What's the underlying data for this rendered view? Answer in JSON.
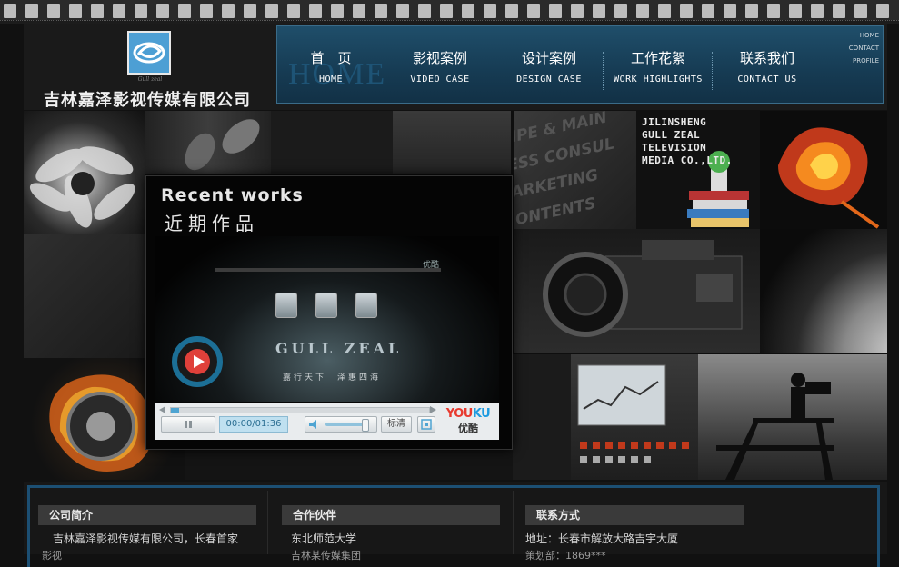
{
  "header": {
    "company_name": "吉林嘉泽影视传媒有限公司",
    "logo_sub": "Gull zeal"
  },
  "nav": {
    "ghost_text": "HOME",
    "items": [
      {
        "cn": "首　页",
        "en": "HOME"
      },
      {
        "cn": "影视案例",
        "en": "VIDEO CASE"
      },
      {
        "cn": "设计案例",
        "en": "DESIGN CASE"
      },
      {
        "cn": "工作花絮",
        "en": "WORK HIGHLIGHTS"
      },
      {
        "cn": "联系我们",
        "en": "CONTACT US"
      }
    ],
    "side_links": [
      "HOME",
      "CONTACT",
      "PROFILE"
    ]
  },
  "showcase": {
    "recent_title": "Recent works",
    "recent_cn": "近期作品",
    "jilin_lines": [
      "JILINSHENG",
      "GULL ZEAL",
      "TELEVISION",
      "MEDIA CO.,LTD."
    ]
  },
  "player": {
    "screen_provider": "优酷",
    "screen_brand": "GULL ZEAL",
    "screen_slogan": "嘉行天下　泽惠四海",
    "time": "00:00/01:36",
    "quality": "标清",
    "youku_en_a": "YOU",
    "youku_en_b": "KU",
    "youku_cn": "优酷",
    "progress": 0.03,
    "volume": 0.9
  },
  "footer": {
    "about": {
      "heading": "公司简介",
      "text": "吉林嘉泽影视传媒有限公司，长春首家",
      "text2": "影视"
    },
    "partners": {
      "heading": "合作伙伴",
      "text": "东北师范大学",
      "text2": "吉林某传媒集团"
    },
    "contact": {
      "heading": "联系方式",
      "text": "地址：长春市解放大路吉宇大厦",
      "text2": "策划部：1869***"
    }
  },
  "colors": {
    "nav_bg": "#1f4e6a",
    "accent_blue": "#1c6f96",
    "youku_red": "#e83a2f",
    "youku_blue": "#1e9be0"
  }
}
